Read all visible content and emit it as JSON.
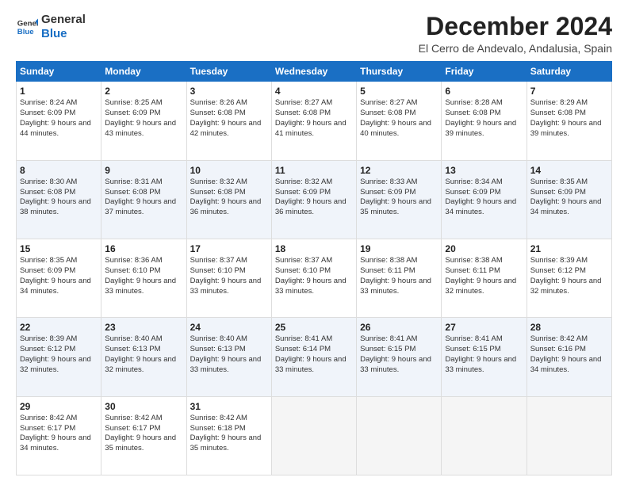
{
  "logo": {
    "general": "General",
    "blue": "Blue"
  },
  "title": "December 2024",
  "location": "El Cerro de Andevalo, Andalusia, Spain",
  "days_of_week": [
    "Sunday",
    "Monday",
    "Tuesday",
    "Wednesday",
    "Thursday",
    "Friday",
    "Saturday"
  ],
  "weeks": [
    [
      {
        "day": 1,
        "sunrise": "Sunrise: 8:24 AM",
        "sunset": "Sunset: 6:09 PM",
        "daylight": "Daylight: 9 hours and 44 minutes."
      },
      {
        "day": 2,
        "sunrise": "Sunrise: 8:25 AM",
        "sunset": "Sunset: 6:09 PM",
        "daylight": "Daylight: 9 hours and 43 minutes."
      },
      {
        "day": 3,
        "sunrise": "Sunrise: 8:26 AM",
        "sunset": "Sunset: 6:08 PM",
        "daylight": "Daylight: 9 hours and 42 minutes."
      },
      {
        "day": 4,
        "sunrise": "Sunrise: 8:27 AM",
        "sunset": "Sunset: 6:08 PM",
        "daylight": "Daylight: 9 hours and 41 minutes."
      },
      {
        "day": 5,
        "sunrise": "Sunrise: 8:27 AM",
        "sunset": "Sunset: 6:08 PM",
        "daylight": "Daylight: 9 hours and 40 minutes."
      },
      {
        "day": 6,
        "sunrise": "Sunrise: 8:28 AM",
        "sunset": "Sunset: 6:08 PM",
        "daylight": "Daylight: 9 hours and 39 minutes."
      },
      {
        "day": 7,
        "sunrise": "Sunrise: 8:29 AM",
        "sunset": "Sunset: 6:08 PM",
        "daylight": "Daylight: 9 hours and 39 minutes."
      }
    ],
    [
      {
        "day": 8,
        "sunrise": "Sunrise: 8:30 AM",
        "sunset": "Sunset: 6:08 PM",
        "daylight": "Daylight: 9 hours and 38 minutes."
      },
      {
        "day": 9,
        "sunrise": "Sunrise: 8:31 AM",
        "sunset": "Sunset: 6:08 PM",
        "daylight": "Daylight: 9 hours and 37 minutes."
      },
      {
        "day": 10,
        "sunrise": "Sunrise: 8:32 AM",
        "sunset": "Sunset: 6:08 PM",
        "daylight": "Daylight: 9 hours and 36 minutes."
      },
      {
        "day": 11,
        "sunrise": "Sunrise: 8:32 AM",
        "sunset": "Sunset: 6:09 PM",
        "daylight": "Daylight: 9 hours and 36 minutes."
      },
      {
        "day": 12,
        "sunrise": "Sunrise: 8:33 AM",
        "sunset": "Sunset: 6:09 PM",
        "daylight": "Daylight: 9 hours and 35 minutes."
      },
      {
        "day": 13,
        "sunrise": "Sunrise: 8:34 AM",
        "sunset": "Sunset: 6:09 PM",
        "daylight": "Daylight: 9 hours and 34 minutes."
      },
      {
        "day": 14,
        "sunrise": "Sunrise: 8:35 AM",
        "sunset": "Sunset: 6:09 PM",
        "daylight": "Daylight: 9 hours and 34 minutes."
      }
    ],
    [
      {
        "day": 15,
        "sunrise": "Sunrise: 8:35 AM",
        "sunset": "Sunset: 6:09 PM",
        "daylight": "Daylight: 9 hours and 34 minutes."
      },
      {
        "day": 16,
        "sunrise": "Sunrise: 8:36 AM",
        "sunset": "Sunset: 6:10 PM",
        "daylight": "Daylight: 9 hours and 33 minutes."
      },
      {
        "day": 17,
        "sunrise": "Sunrise: 8:37 AM",
        "sunset": "Sunset: 6:10 PM",
        "daylight": "Daylight: 9 hours and 33 minutes."
      },
      {
        "day": 18,
        "sunrise": "Sunrise: 8:37 AM",
        "sunset": "Sunset: 6:10 PM",
        "daylight": "Daylight: 9 hours and 33 minutes."
      },
      {
        "day": 19,
        "sunrise": "Sunrise: 8:38 AM",
        "sunset": "Sunset: 6:11 PM",
        "daylight": "Daylight: 9 hours and 33 minutes."
      },
      {
        "day": 20,
        "sunrise": "Sunrise: 8:38 AM",
        "sunset": "Sunset: 6:11 PM",
        "daylight": "Daylight: 9 hours and 32 minutes."
      },
      {
        "day": 21,
        "sunrise": "Sunrise: 8:39 AM",
        "sunset": "Sunset: 6:12 PM",
        "daylight": "Daylight: 9 hours and 32 minutes."
      }
    ],
    [
      {
        "day": 22,
        "sunrise": "Sunrise: 8:39 AM",
        "sunset": "Sunset: 6:12 PM",
        "daylight": "Daylight: 9 hours and 32 minutes."
      },
      {
        "day": 23,
        "sunrise": "Sunrise: 8:40 AM",
        "sunset": "Sunset: 6:13 PM",
        "daylight": "Daylight: 9 hours and 32 minutes."
      },
      {
        "day": 24,
        "sunrise": "Sunrise: 8:40 AM",
        "sunset": "Sunset: 6:13 PM",
        "daylight": "Daylight: 9 hours and 33 minutes."
      },
      {
        "day": 25,
        "sunrise": "Sunrise: 8:41 AM",
        "sunset": "Sunset: 6:14 PM",
        "daylight": "Daylight: 9 hours and 33 minutes."
      },
      {
        "day": 26,
        "sunrise": "Sunrise: 8:41 AM",
        "sunset": "Sunset: 6:15 PM",
        "daylight": "Daylight: 9 hours and 33 minutes."
      },
      {
        "day": 27,
        "sunrise": "Sunrise: 8:41 AM",
        "sunset": "Sunset: 6:15 PM",
        "daylight": "Daylight: 9 hours and 33 minutes."
      },
      {
        "day": 28,
        "sunrise": "Sunrise: 8:42 AM",
        "sunset": "Sunset: 6:16 PM",
        "daylight": "Daylight: 9 hours and 34 minutes."
      }
    ],
    [
      {
        "day": 29,
        "sunrise": "Sunrise: 8:42 AM",
        "sunset": "Sunset: 6:17 PM",
        "daylight": "Daylight: 9 hours and 34 minutes."
      },
      {
        "day": 30,
        "sunrise": "Sunrise: 8:42 AM",
        "sunset": "Sunset: 6:17 PM",
        "daylight": "Daylight: 9 hours and 35 minutes."
      },
      {
        "day": 31,
        "sunrise": "Sunrise: 8:42 AM",
        "sunset": "Sunset: 6:18 PM",
        "daylight": "Daylight: 9 hours and 35 minutes."
      },
      null,
      null,
      null,
      null
    ]
  ]
}
